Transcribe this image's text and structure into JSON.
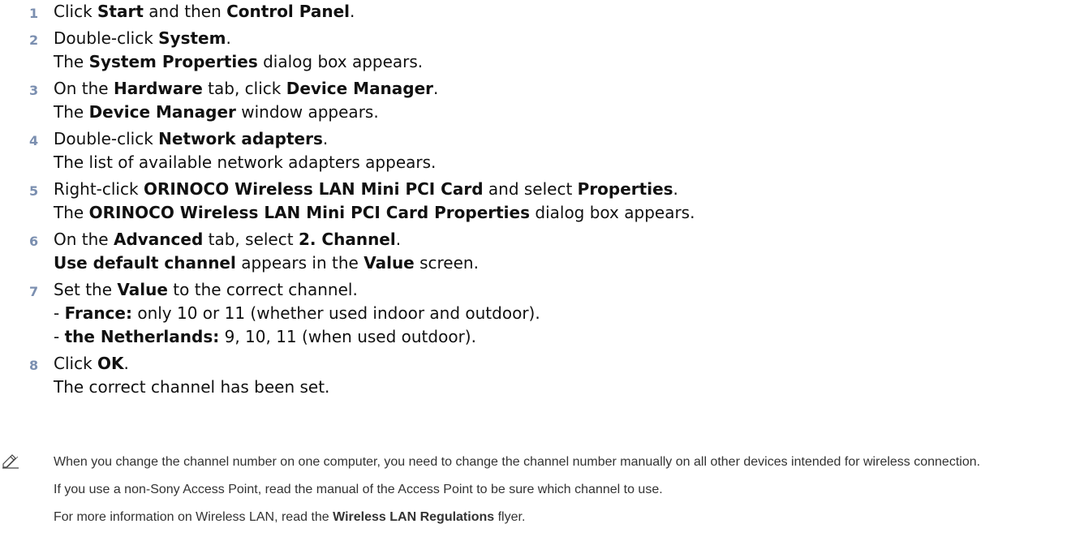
{
  "steps": [
    {
      "num": "1",
      "lines": [
        [
          {
            "t": "Click "
          },
          {
            "t": "Start",
            "b": true
          },
          {
            "t": " and then "
          },
          {
            "t": "Control Panel",
            "b": true
          },
          {
            "t": "."
          }
        ]
      ]
    },
    {
      "num": "2",
      "lines": [
        [
          {
            "t": "Double-click "
          },
          {
            "t": "System",
            "b": true
          },
          {
            "t": "."
          }
        ],
        [
          {
            "t": "The "
          },
          {
            "t": "System Properties",
            "b": true
          },
          {
            "t": " dialog box appears."
          }
        ]
      ]
    },
    {
      "num": "3",
      "lines": [
        [
          {
            "t": "On the "
          },
          {
            "t": "Hardware",
            "b": true
          },
          {
            "t": " tab, click "
          },
          {
            "t": "Device Manager",
            "b": true
          },
          {
            "t": "."
          }
        ],
        [
          {
            "t": "The "
          },
          {
            "t": "Device Manager",
            "b": true
          },
          {
            "t": " window appears."
          }
        ]
      ]
    },
    {
      "num": "4",
      "lines": [
        [
          {
            "t": "Double-click "
          },
          {
            "t": "Network adapters",
            "b": true
          },
          {
            "t": "."
          }
        ],
        [
          {
            "t": "The list of available network adapters appears."
          }
        ]
      ]
    },
    {
      "num": "5",
      "lines": [
        [
          {
            "t": "Right-click "
          },
          {
            "t": "ORINOCO Wireless LAN Mini PCI Card",
            "b": true
          },
          {
            "t": " and select "
          },
          {
            "t": "Properties",
            "b": true
          },
          {
            "t": "."
          }
        ],
        [
          {
            "t": "The "
          },
          {
            "t": "ORINOCO Wireless LAN Mini PCI Card Properties",
            "b": true
          },
          {
            "t": " dialog box appears."
          }
        ]
      ]
    },
    {
      "num": "6",
      "lines": [
        [
          {
            "t": "On the "
          },
          {
            "t": "Advanced",
            "b": true
          },
          {
            "t": " tab, select "
          },
          {
            "t": "2. Channel",
            "b": true
          },
          {
            "t": "."
          }
        ],
        [
          {
            "t": "Use default channel",
            "b": true
          },
          {
            "t": " appears in the "
          },
          {
            "t": "Value",
            "b": true
          },
          {
            "t": " screen."
          }
        ]
      ]
    },
    {
      "num": "7",
      "lines": [
        [
          {
            "t": "Set the "
          },
          {
            "t": "Value",
            "b": true
          },
          {
            "t": " to the correct channel."
          }
        ],
        [
          {
            "t": "- "
          },
          {
            "t": "France:",
            "b": true
          },
          {
            "t": " only 10 or 11 (whether used indoor and outdoor)."
          }
        ],
        [
          {
            "t": "- "
          },
          {
            "t": "the Netherlands:",
            "b": true
          },
          {
            "t": " 9, 10, 11 (when used outdoor)."
          }
        ]
      ]
    },
    {
      "num": "8",
      "lines": [
        [
          {
            "t": "Click "
          },
          {
            "t": "OK",
            "b": true
          },
          {
            "t": "."
          }
        ],
        [
          {
            "t": "The correct channel has been set."
          }
        ]
      ]
    }
  ],
  "notes": [
    [
      {
        "t": "When you change the channel number on one computer, you need to change the channel number manually on all other devices intended for wireless connection."
      }
    ],
    [
      {
        "t": "If you use a non-Sony Access Point, read the manual of the Access Point to be sure which channel to use."
      }
    ],
    [
      {
        "t": "For more information on Wireless LAN, read the "
      },
      {
        "t": "Wireless LAN Regulations",
        "b": true
      },
      {
        "t": " flyer."
      }
    ]
  ],
  "icons": {
    "note": "pencil-note-icon"
  },
  "colors": {
    "step_number": "#7b8fb0",
    "text": "#111111",
    "note_text": "#333333"
  }
}
